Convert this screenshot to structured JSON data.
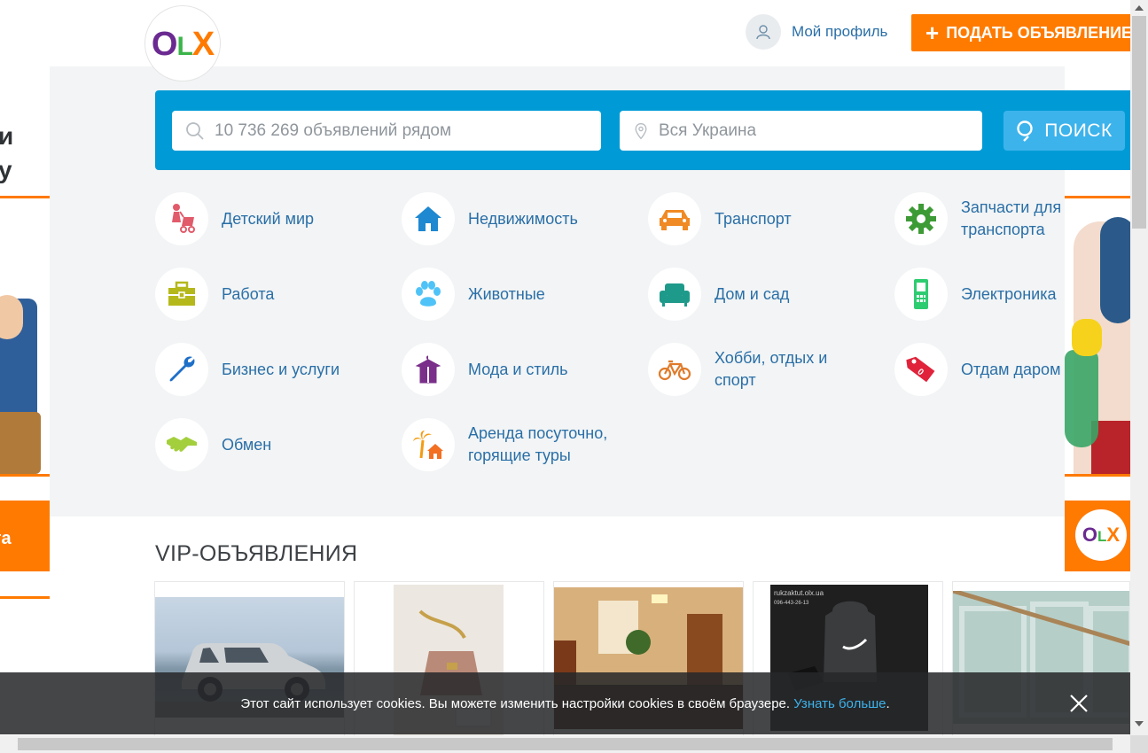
{
  "header": {
    "logo_text": "OLX",
    "profile_label": "Мой профиль",
    "post_button_plus": "+",
    "post_button_label": "ПОДАТЬ ОБЪЯВЛЕНИЕ"
  },
  "left_banner": {
    "text_line1": "и",
    "text_line2": "у",
    "cta_text": "ота"
  },
  "right_banner": {
    "logo_text": "OLX"
  },
  "search": {
    "query_placeholder": "10 736 269 объявлений рядом",
    "location_placeholder": "Вся Украина",
    "button_label": "ПОИСК"
  },
  "categories": [
    {
      "label": "Детский мир",
      "icon": "stroller-icon",
      "color": "#e15b6b"
    },
    {
      "label": "Недвижимость",
      "icon": "house-icon",
      "color": "#1e88d1"
    },
    {
      "label": "Транспорт",
      "icon": "car-icon",
      "color": "#f08a24"
    },
    {
      "label": "Запчасти для транспорта",
      "icon": "gear-icon",
      "color": "#3d9b35"
    },
    {
      "label": "Работа",
      "icon": "briefcase-icon",
      "color": "#b5b81a"
    },
    {
      "label": "Животные",
      "icon": "paw-icon",
      "color": "#4fc3f7"
    },
    {
      "label": "Дом и сад",
      "icon": "armchair-icon",
      "color": "#1e9a8a"
    },
    {
      "label": "Электроника",
      "icon": "phone-icon",
      "color": "#2ecc71"
    },
    {
      "label": "Бизнес и услуги",
      "icon": "wrench-icon",
      "color": "#1e6fc8"
    },
    {
      "label": "Мода и стиль",
      "icon": "clothes-icon",
      "color": "#7a2f8a"
    },
    {
      "label": "Хобби, отдых и спорт",
      "icon": "bicycle-icon",
      "color": "#e07b2a"
    },
    {
      "label": "Отдам даром",
      "icon": "price-tag-icon",
      "color": "#e0233b"
    },
    {
      "label": "Обмен",
      "icon": "handshake-icon",
      "color": "#a3cf3c"
    },
    {
      "label": "Аренда посуточно, горящие туры",
      "icon": "palm-house-icon",
      "color": "#f39c12"
    }
  ],
  "vip": {
    "title": "VIP-ОБЪЯВЛЕНИЯ",
    "cards": [
      {
        "image": "silver-suv-photo",
        "watermark": "mercedes.olx"
      },
      {
        "image": "handbag-photo"
      },
      {
        "image": "interior-room-photo"
      },
      {
        "image": "backpack-photo",
        "watermark": "rukzaktut.olx.ua",
        "phone": "096-443-26-13"
      },
      {
        "image": "window-frames-photo"
      }
    ]
  },
  "cookie": {
    "text": "Этот сайт использует cookies. Вы можете изменить настройки cookies в своём браузере.",
    "link": "Узнать больше",
    "suffix": "."
  }
}
